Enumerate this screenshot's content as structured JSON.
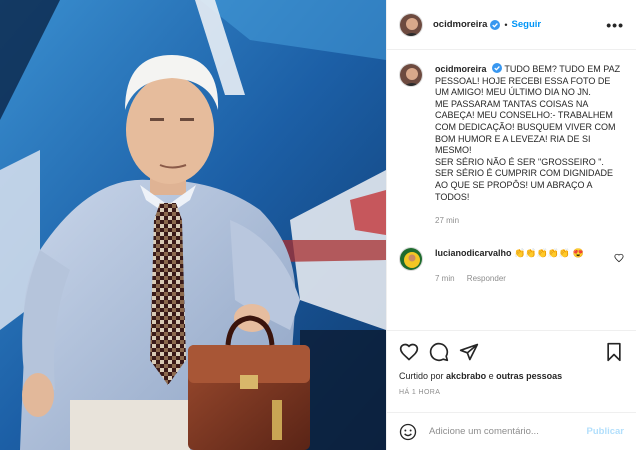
{
  "post": {
    "username": "ocidmoreira",
    "follow_label": "Seguir",
    "more_label": "•••",
    "dot": "•"
  },
  "caption": {
    "username": "ocidmoreira",
    "text": "TUDO BEM? TUDO EM PAZ PESSOAL! HOJE RECEBI ESSA FOTO DE UM AMIGO! MEU ÚLTIMO DIA NO JN.\nME PASSARAM TANTAS COISAS NA CABEÇA! MEU CONSELHO:- TRABALHEM COM DEDICAÇÃO! BUSQUEM VIVER COM BOM HUMOR E A LEVEZA! RIA DE SI MESMO!\nSER SÉRIO NÃO É SER \"GROSSEIRO \".\nSER SÉRIO É CUMPRIR COM DIGNIDADE AO QUE SE PROPÔS! UM ABRAÇO A TODOS!",
    "time": "27 min"
  },
  "comments": [
    {
      "username": "lucianodicarvalho",
      "text": "👏👏👏👏👏 😍",
      "time": "7 min",
      "reply_label": "Responder"
    }
  ],
  "actions": {
    "liked_prefix": "Curtido por",
    "liked_user": "akcbrabo",
    "liked_mid": "e",
    "liked_others": "outras pessoas",
    "timestamp": "HÁ 1 HORA"
  },
  "composer": {
    "placeholder": "Adicione um comentário...",
    "publish_label": "Publicar"
  },
  "colors": {
    "link_blue": "#0095f6",
    "publish_disabled": "#b2dffc",
    "meta_gray": "#8e8e8e"
  },
  "icons": [
    "verified-icon",
    "more-icon",
    "heart-icon",
    "comment-icon",
    "share-icon",
    "save-icon",
    "emoji-icon"
  ]
}
